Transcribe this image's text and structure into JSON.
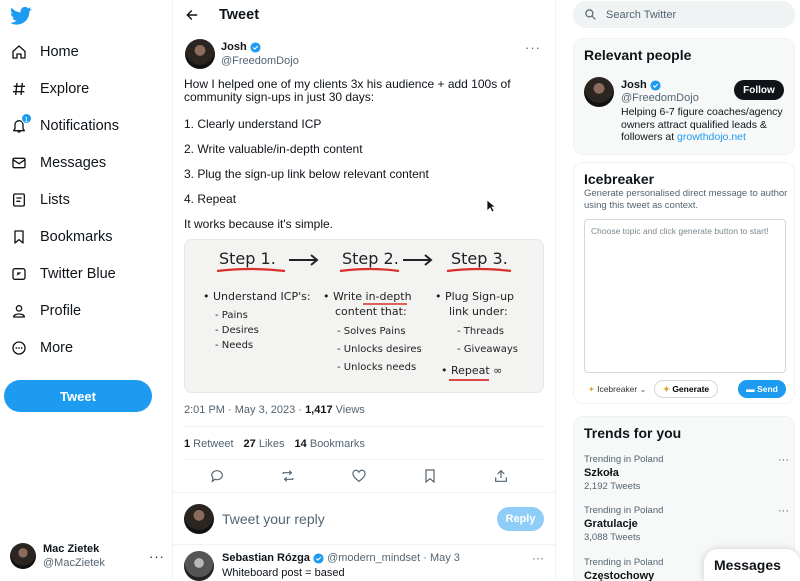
{
  "nav": {
    "items": [
      {
        "label": "Home",
        "icon": "home-icon"
      },
      {
        "label": "Explore",
        "icon": "hash-icon"
      },
      {
        "label": "Notifications",
        "icon": "bell-icon",
        "badge": "1"
      },
      {
        "label": "Messages",
        "icon": "envelope-icon"
      },
      {
        "label": "Lists",
        "icon": "list-icon"
      },
      {
        "label": "Bookmarks",
        "icon": "bookmark-icon"
      },
      {
        "label": "Twitter Blue",
        "icon": "twitter-blue-icon"
      },
      {
        "label": "Profile",
        "icon": "person-icon"
      },
      {
        "label": "More",
        "icon": "more-circle-icon"
      }
    ],
    "tweet_button": "Tweet",
    "account": {
      "name": "Mac Zietek",
      "handle": "@MacZietek"
    }
  },
  "header": {
    "title": "Tweet"
  },
  "tweet": {
    "author": {
      "name": "Josh",
      "handle": "@FreedomDojo"
    },
    "text": {
      "intro": "How I  helped one of my clients 3x his audience + add 100s of community sign-ups in just 30 days:",
      "line1": "1. Clearly understand ICP",
      "line2": "2. Write valuable/in-depth content",
      "line3": "3. Plug the sign-up link below relevant content",
      "line4": "4. Repeat",
      "line5": "It works because it's simple."
    },
    "image": {
      "step1": "Step 1.",
      "step2": "Step 2.",
      "step3": "Step 3.",
      "col1": [
        "• Understand ICP's:",
        "- Pains",
        "- Desires",
        "- Needs"
      ],
      "col2": [
        "• Write in-depth",
        "content that:",
        "- Solves Pains",
        "- Unlocks desires",
        "- Unlocks needs"
      ],
      "col3": [
        "• Plug Sign-up",
        "link under:",
        "- Threads",
        "- Giveaways",
        "• Repeat ∞"
      ]
    },
    "time": "2:01 PM · May 3, 2023 · ",
    "views_count": "1,417",
    "views_label": " Views",
    "stats": {
      "retweets": "1",
      "retweets_label": " Retweet",
      "likes": "27",
      "likes_label": " Likes",
      "bookmarks": "14",
      "bookmarks_label": " Bookmarks"
    }
  },
  "reply_box": {
    "placeholder": "Tweet your reply",
    "button": "Reply"
  },
  "reply": {
    "name": "Sebastian Rózga",
    "handle": "@modern_mindset · May 3",
    "text": "Whiteboard post = based"
  },
  "search": {
    "placeholder": "Search Twitter"
  },
  "relevant": {
    "title": "Relevant people",
    "name": "Josh",
    "handle": "@FreedomDojo",
    "bio": "Helping 6-7 figure coaches/agency owners attract qualified leads & followers at ",
    "bio_link": "growthdojo.net",
    "follow": "Follow"
  },
  "icebreaker": {
    "title": "Icebreaker",
    "desc": "Generate personalised direct message to author using this tweet as context.",
    "placeholder": "Choose topic and click generate button to start!",
    "select": "Icebreaker",
    "generate": "Generate",
    "send": "Send"
  },
  "trends": {
    "title": "Trends for you",
    "items": [
      {
        "context": "Trending in Poland",
        "name": "Szkoła",
        "count": "2,192 Tweets"
      },
      {
        "context": "Trending in Poland",
        "name": "Gratulacje",
        "count": "3,088 Tweets"
      },
      {
        "context": "Trending in Poland",
        "name": "Częstochowy",
        "count": ""
      }
    ]
  },
  "messages_bar": "Messages",
  "colors": {
    "accent": "#1d9bf0",
    "text": "#0f1419",
    "secondary": "#536471"
  }
}
